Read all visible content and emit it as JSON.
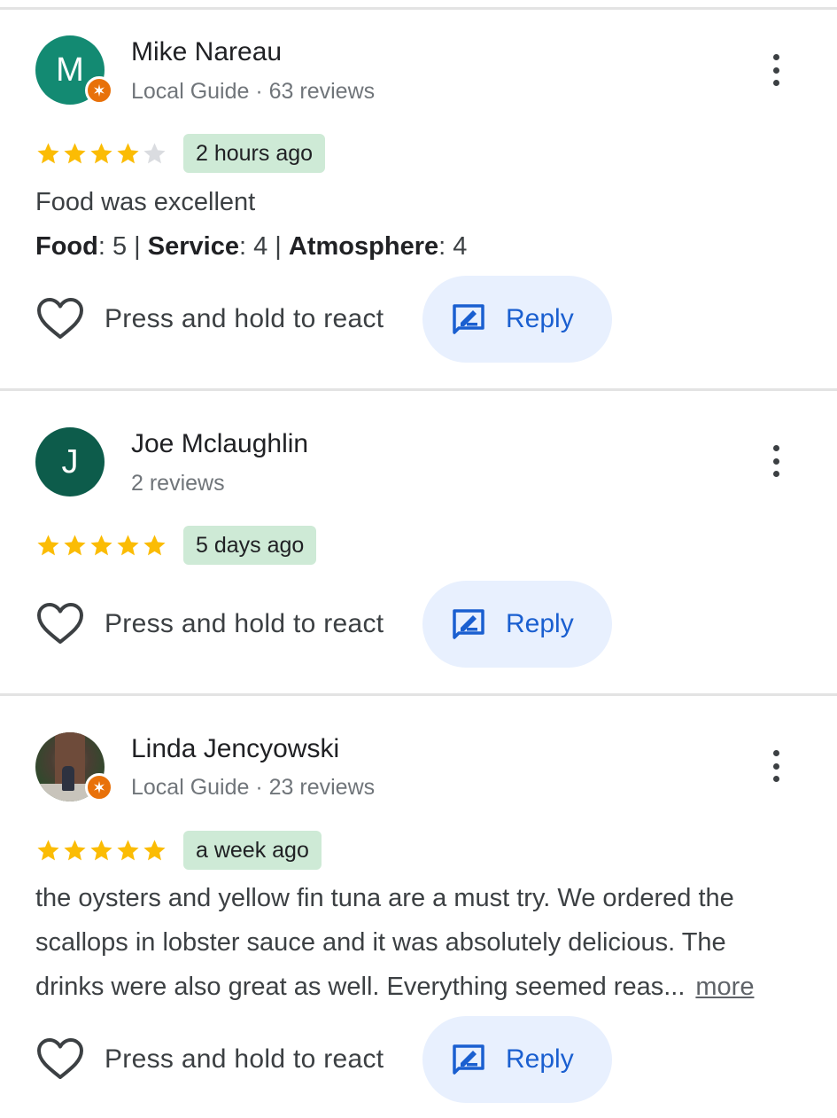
{
  "reviews": [
    {
      "name": "Mike Nareau",
      "avatar_letter": "M",
      "avatar_color": "#138a72",
      "local_guide": true,
      "meta": "Local Guide · 63 reviews",
      "rating": 4,
      "time": "2 hours ago",
      "text": "Food was excellent",
      "subratings": [
        {
          "label": "Food",
          "value": "5"
        },
        {
          "label": "Service",
          "value": "4"
        },
        {
          "label": "Atmosphere",
          "value": "4"
        }
      ],
      "react_label": "Press and hold to react",
      "reply_label": "Reply"
    },
    {
      "name": "Joe Mclaughlin",
      "avatar_letter": "J",
      "avatar_color": "#0d5c4b",
      "local_guide": false,
      "meta": "2 reviews",
      "rating": 5,
      "time": "5 days ago",
      "react_label": "Press and hold to react",
      "reply_label": "Reply"
    },
    {
      "name": "Linda Jencyowski",
      "avatar_type": "photo",
      "local_guide": true,
      "meta": "Local Guide · 23 reviews",
      "rating": 5,
      "time": "a week ago",
      "text_lines": [
        "the oysters and yellow fin tuna are a must try. We ordered the",
        "scallops in lobster sauce and it was absolutely delicious. The",
        "drinks were also great as well. Everything seemed reas..."
      ],
      "more_label": "more",
      "react_label": "Press and hold to react",
      "reply_label": "Reply"
    }
  ],
  "colors": {
    "star_filled": "#fbbc04",
    "star_empty": "#dadce0",
    "time_chip": "#ceead6",
    "reply_bg": "#e8f0fe",
    "reply_text": "#1a5fd0",
    "local_guide_badge": "#e8710a"
  },
  "icons": {
    "more": "more-vert-icon",
    "react": "heart-outline-icon",
    "reply": "reply-edit-icon",
    "badge": "local-guide-star-icon"
  }
}
